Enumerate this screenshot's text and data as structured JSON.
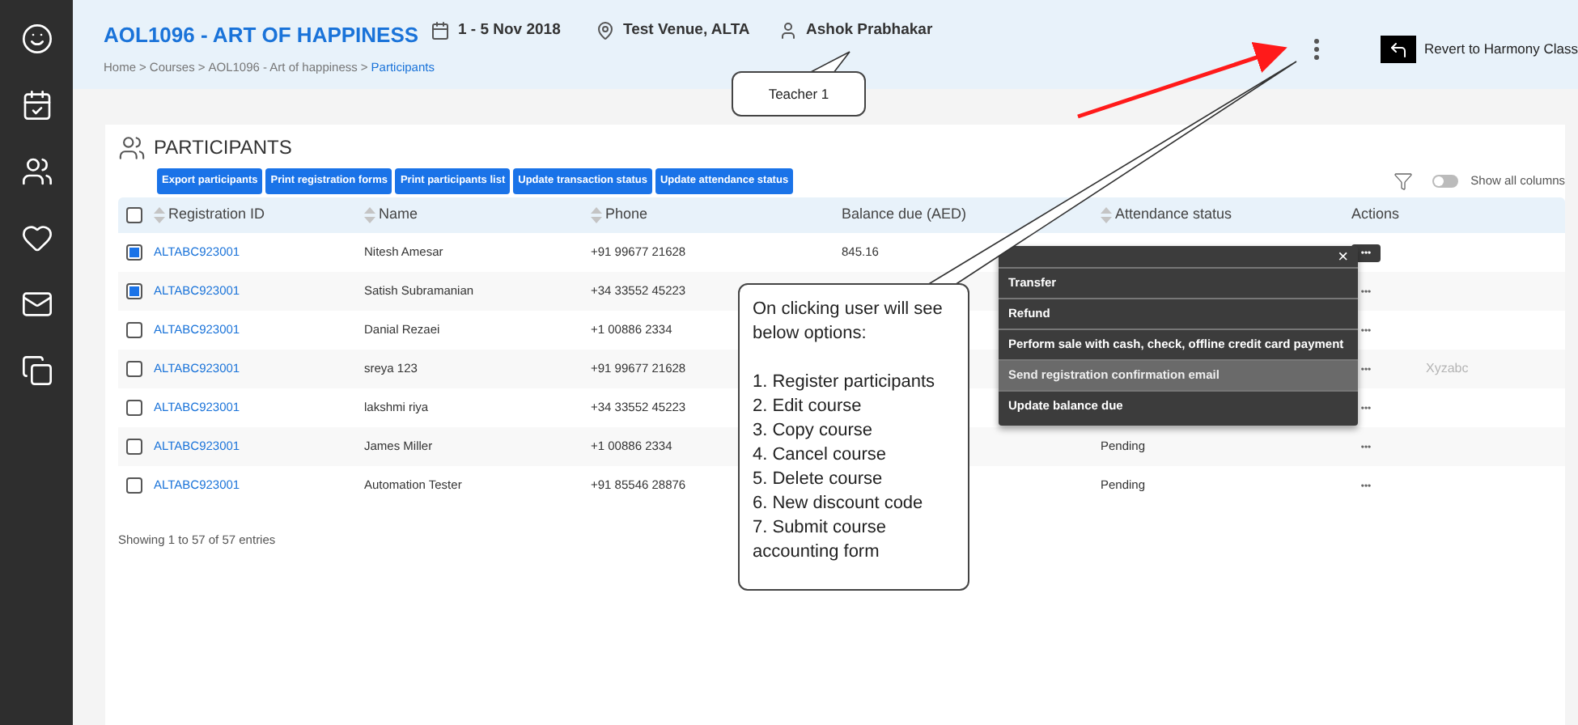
{
  "sidebar": {
    "items": [
      {
        "selected": false
      },
      {
        "selected": false
      },
      {
        "selected": false
      },
      {
        "selected": false
      },
      {
        "selected": false
      },
      {
        "selected": false
      }
    ]
  },
  "header": {
    "title": "AOL1096 - ART OF HAPPINESS",
    "breadcrumb": [
      {
        "label": "Home",
        "current": false
      },
      {
        "label": "Courses",
        "current": false
      },
      {
        "label": "AOL1096 - Art of happiness",
        "current": false
      },
      {
        "label": "Participants",
        "current": true
      }
    ],
    "separator": ">",
    "meta": [
      {
        "text": "1 - 5 Nov 2018"
      },
      {
        "text": "Test Venue, ALTA"
      },
      {
        "text": "Ashok Prabhakar"
      }
    ],
    "revert_button": "Revert to Harmony Class"
  },
  "participants": {
    "title": "PARTICIPANTS",
    "buttons": [
      "Export participants",
      "Print registration forms",
      "Print participants list",
      "Update transaction status",
      "Update attendance status"
    ],
    "show_all_columns": {
      "label": "Show all columns",
      "on": false
    },
    "select_all_checked": false,
    "columns": [
      {
        "label": "Registration ID",
        "sortable": true
      },
      {
        "label": "Name",
        "sortable": true
      },
      {
        "label": "Phone",
        "sortable": true
      },
      {
        "label": "Balance due (AED)",
        "sortable": false
      },
      {
        "label": "Attendance status",
        "sortable": true
      },
      {
        "label": "Actions",
        "sortable": false
      }
    ],
    "rows": [
      {
        "checked": true,
        "id": "ALTABC923001",
        "name": "Nitesh Amesar",
        "phone": "+91 99677 21628",
        "balance": "845.16",
        "attendance": "",
        "actions": "•••",
        "menu_open": true
      },
      {
        "checked": true,
        "id": "ALTABC923001",
        "name": "Satish Subramanian",
        "phone": "+34 33552 45223",
        "balance": "",
        "attendance": "",
        "actions": "•••",
        "menu_open": false
      },
      {
        "checked": false,
        "id": "ALTABC923001",
        "name": "Danial Rezaei",
        "phone": "+1 00886 2334",
        "balance": "",
        "attendance": "",
        "actions": "•••",
        "menu_open": false
      },
      {
        "checked": false,
        "id": "ALTABC923001",
        "name": "sreya 123",
        "phone": "+91 99677 21628",
        "balance": "",
        "attendance": "",
        "actions": "•••",
        "menu_open": false,
        "note": "Xyzabc"
      },
      {
        "checked": false,
        "id": "ALTABC923001",
        "name": "lakshmi riya",
        "phone": "+34 33552 45223",
        "balance": "",
        "attendance": "",
        "actions": "•••",
        "menu_open": false
      },
      {
        "checked": false,
        "id": "ALTABC923001",
        "name": "James Miller",
        "phone": "+1 00886 2334",
        "balance": "",
        "attendance": "Pending",
        "actions": "•••",
        "menu_open": false
      },
      {
        "checked": false,
        "id": "ALTABC923001",
        "name": "Automation Tester",
        "phone": "+91 85546 28876",
        "balance": "",
        "attendance": "Pending",
        "actions": "•••",
        "menu_open": false
      }
    ],
    "footer": "Showing 1 to 57 of 57 entries"
  },
  "action_menu": {
    "close": "×",
    "items": [
      {
        "label": "Transfer",
        "highlighted": false
      },
      {
        "label": "Refund",
        "highlighted": false
      },
      {
        "label": "Perform sale with cash, check, offline credit card payment",
        "highlighted": false
      },
      {
        "label": "Send registration confirmation email",
        "highlighted": true
      },
      {
        "label": "Update balance due",
        "highlighted": false
      }
    ]
  },
  "annotations": {
    "teacher_callout": "Teacher 1",
    "options_callout": {
      "intro": "On clicking user will see below options:",
      "options": [
        "1. Register participants",
        "2. Edit course",
        "3. Copy course",
        "4. Cancel course",
        "5. Delete course",
        "6. New discount code",
        "7. Submit course accounting form"
      ]
    }
  }
}
